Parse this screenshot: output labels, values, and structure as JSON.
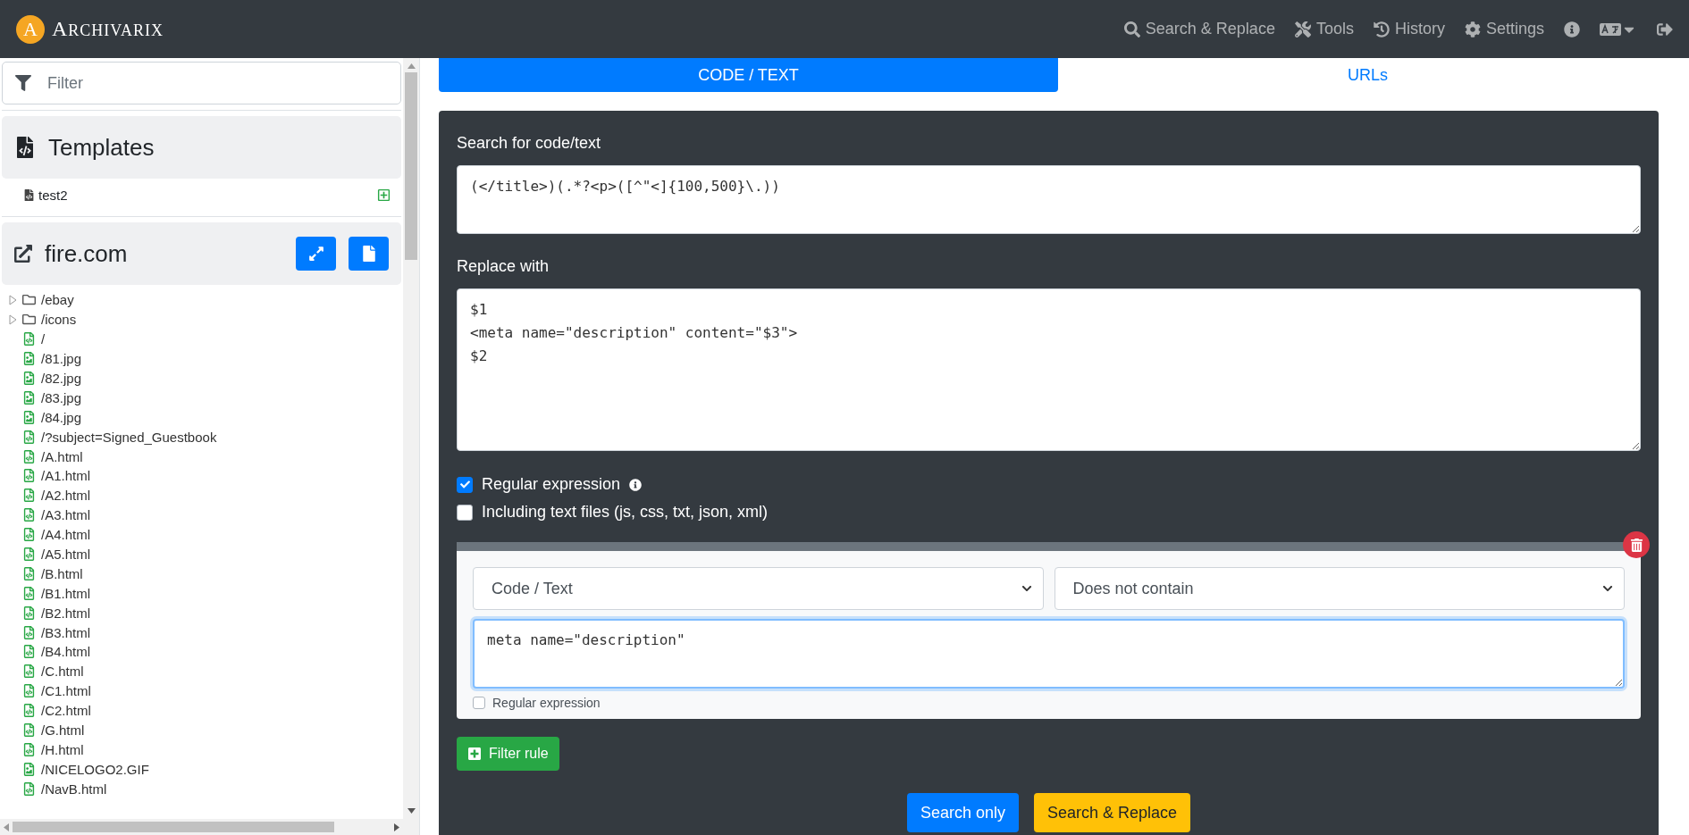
{
  "navbar": {
    "logo_letter": "A",
    "brand": "ARCHIVARIX",
    "links": [
      {
        "kind": "search",
        "label": "Search & Replace"
      },
      {
        "kind": "tools",
        "label": "Tools"
      },
      {
        "kind": "history",
        "label": "History"
      },
      {
        "kind": "settings",
        "label": "Settings"
      }
    ]
  },
  "sidebar": {
    "filter": {
      "placeholder": "Filter"
    },
    "templates": {
      "title": "Templates",
      "items": [
        {
          "name": "test2"
        }
      ]
    },
    "site": {
      "title": "fire.com"
    },
    "tree": [
      {
        "kind": "folder",
        "name": "/ebay",
        "expanded": false
      },
      {
        "kind": "folder",
        "name": "/icons",
        "expanded": false
      },
      {
        "kind": "code",
        "name": "/"
      },
      {
        "kind": "image",
        "name": "/81.jpg"
      },
      {
        "kind": "image",
        "name": "/82.jpg"
      },
      {
        "kind": "image",
        "name": "/83.jpg"
      },
      {
        "kind": "image",
        "name": "/84.jpg"
      },
      {
        "kind": "code",
        "name": "/?subject=Signed_Guestbook"
      },
      {
        "kind": "code",
        "name": "/A.html"
      },
      {
        "kind": "code",
        "name": "/A1.html"
      },
      {
        "kind": "code",
        "name": "/A2.html"
      },
      {
        "kind": "code",
        "name": "/A3.html"
      },
      {
        "kind": "code",
        "name": "/A4.html"
      },
      {
        "kind": "code",
        "name": "/A5.html"
      },
      {
        "kind": "code",
        "name": "/B.html"
      },
      {
        "kind": "code",
        "name": "/B1.html"
      },
      {
        "kind": "code",
        "name": "/B2.html"
      },
      {
        "kind": "code",
        "name": "/B3.html"
      },
      {
        "kind": "code",
        "name": "/B4.html"
      },
      {
        "kind": "code",
        "name": "/C.html"
      },
      {
        "kind": "code",
        "name": "/C1.html"
      },
      {
        "kind": "code",
        "name": "/C2.html"
      },
      {
        "kind": "code",
        "name": "/G.html"
      },
      {
        "kind": "code",
        "name": "/H.html"
      },
      {
        "kind": "image",
        "name": "/NICELOGO2.GIF"
      },
      {
        "kind": "code",
        "name": "/NavB.html"
      }
    ]
  },
  "tabs": [
    {
      "label": "CODE / TEXT",
      "selected": true
    },
    {
      "label": "URLs",
      "selected": false
    }
  ],
  "form": {
    "search_label": "Search for code/text",
    "search_value": "(</title>)(.*?<p>([^\"<]{100,500}\\.))",
    "replace_label": "Replace with",
    "replace_value": "$1\n<meta name=\"description\" content=\"$3\">\n$2",
    "options": [
      {
        "label": "Regular expression",
        "checked": true,
        "info": true
      },
      {
        "label": "Including text files (js, css, txt, json, xml)",
        "checked": false,
        "info": false
      }
    ],
    "rule": {
      "field": "Code / Text",
      "condition": "Does not contain",
      "value": "meta name=\"description\"",
      "regex": {
        "label": "Regular expression",
        "checked": false
      }
    },
    "add_rule": "Filter rule",
    "buttons": [
      {
        "kind": "primary",
        "label": "Search only"
      },
      {
        "kind": "warning",
        "label": "Search & Replace"
      }
    ]
  }
}
